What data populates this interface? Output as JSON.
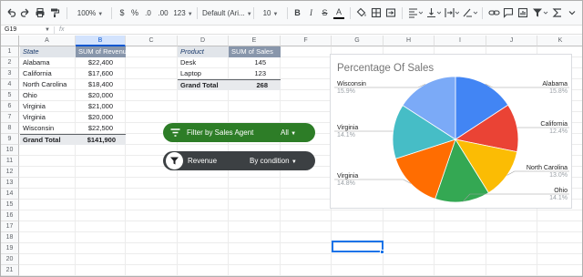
{
  "toolbar": {
    "zoom": "100%",
    "currency": "$",
    "percent": "%",
    "dec_decrease": ".0",
    "dec_increase": ".00",
    "more_formats": "123",
    "font": "Default (Ari...",
    "font_size": "10",
    "bold": "B",
    "italic": "I",
    "strike": "S",
    "text_color": "A"
  },
  "formula_bar": {
    "name_box": "G19",
    "fx": "fx"
  },
  "columns": [
    "A",
    "B",
    "C",
    "D",
    "E",
    "F",
    "G",
    "H",
    "I",
    "J",
    "K"
  ],
  "rows": [
    "1",
    "2",
    "3",
    "4",
    "5",
    "6",
    "7",
    "8",
    "9",
    "10",
    "11",
    "12",
    "13",
    "14",
    "15",
    "16",
    "17",
    "18",
    "19",
    "20",
    "21"
  ],
  "pivot_agent": {
    "header": [
      "State",
      "SUM of Revenue"
    ],
    "rows": [
      [
        "Alabama",
        "$22,400"
      ],
      [
        "California",
        "$17,600"
      ],
      [
        "North Carolina",
        "$18,400"
      ],
      [
        "Ohio",
        "$20,000"
      ],
      [
        "Virginia",
        "$21,000"
      ],
      [
        "Virginia",
        "$20,000"
      ],
      [
        "Wisconsin",
        "$22,500"
      ]
    ],
    "total": [
      "Grand Total",
      "$141,900"
    ]
  },
  "pivot_product": {
    "header": [
      "Product",
      "SUM of Sales"
    ],
    "rows": [
      [
        "Desk",
        "145"
      ],
      [
        "Laptop",
        "123"
      ]
    ],
    "total": [
      "Grand Total",
      "268"
    ]
  },
  "filters": {
    "agent": {
      "label": "Filter by Sales Agent",
      "value": "All"
    },
    "revenue": {
      "label": "Revenue",
      "value": "By condition"
    }
  },
  "colors": {
    "agent_chip": "#2d7d27",
    "revenue_chip": "#3c4043",
    "selection": "#1a73e8"
  },
  "chart_data": {
    "type": "pie",
    "title": "Percentage Of Sales",
    "slices": [
      {
        "label": "Alabama",
        "value": 15.8,
        "pct": "15.8%",
        "color": "#4285f4"
      },
      {
        "label": "California",
        "value": 12.4,
        "pct": "12.4%",
        "color": "#ea4335"
      },
      {
        "label": "North Carolina",
        "value": 13.0,
        "pct": "13.0%",
        "color": "#fbbc04"
      },
      {
        "label": "Ohio",
        "value": 14.1,
        "pct": "14.1%",
        "color": "#34a853"
      },
      {
        "label": "Virginia",
        "value": 14.8,
        "pct": "14.8%",
        "color": "#ff6d01"
      },
      {
        "label": "Virginia",
        "value": 14.1,
        "pct": "14.1%",
        "color": "#46bdc6"
      },
      {
        "label": "Wisconsin",
        "value": 15.9,
        "pct": "15.9%",
        "color": "#7baaf7"
      }
    ]
  }
}
